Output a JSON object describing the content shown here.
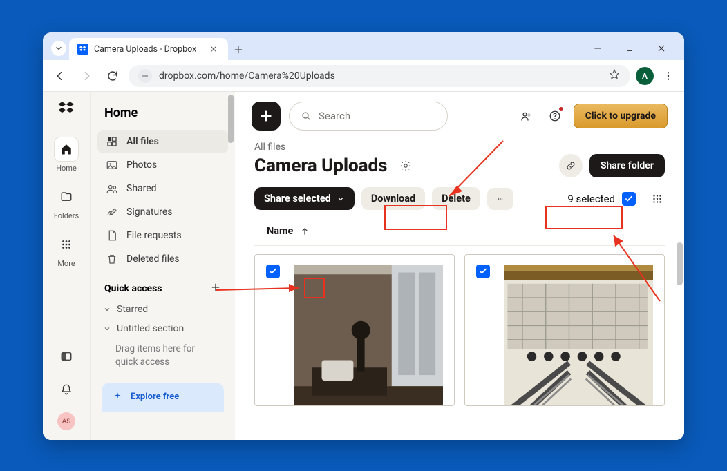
{
  "browser": {
    "tab_title": "Camera Uploads - Dropbox",
    "url": "dropbox.com/home/Camera%20Uploads",
    "profile_initial": "A"
  },
  "rail": {
    "items": [
      {
        "label": "Home",
        "icon": "home-icon",
        "active": true
      },
      {
        "label": "Folders",
        "icon": "folder-icon",
        "active": false
      },
      {
        "label": "More",
        "icon": "grid-dots-icon",
        "active": false
      }
    ],
    "avatar_initials": "AS"
  },
  "sidebar": {
    "heading": "Home",
    "items": [
      {
        "label": "All files",
        "active": true
      },
      {
        "label": "Photos",
        "active": false
      },
      {
        "label": "Shared",
        "active": false
      },
      {
        "label": "Signatures",
        "active": false
      },
      {
        "label": "File requests",
        "active": false
      },
      {
        "label": "Deleted files",
        "active": false
      }
    ],
    "quick_access_label": "Quick access",
    "starred_label": "Starred",
    "untitled_label": "Untitled section",
    "hint": "Drag items here for quick access",
    "explore_label": "Explore free"
  },
  "topbar": {
    "search_placeholder": "Search",
    "upgrade_label": "Click to upgrade"
  },
  "page": {
    "breadcrumb": "All files",
    "title": "Camera Uploads",
    "share_folder_label": "Share folder",
    "share_selected_label": "Share selected",
    "download_label": "Download",
    "delete_label": "Delete",
    "selected_label": "9 selected",
    "name_col": "Name"
  },
  "colors": {
    "accent_blue": "#0061ff",
    "annotation_red": "#e6321e",
    "upgrade_gold": "#e2a73e"
  }
}
